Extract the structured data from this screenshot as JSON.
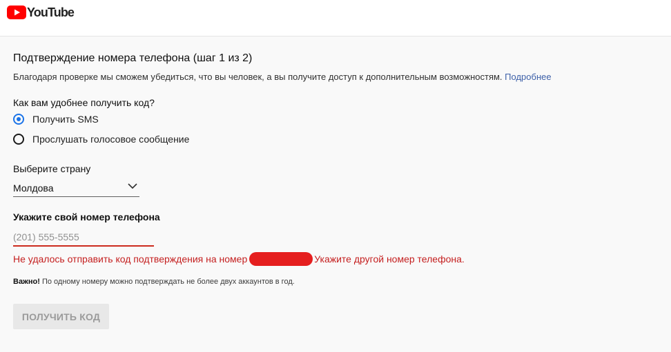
{
  "header": {
    "logo_text": "YouTube",
    "logo_color": "#ff0000"
  },
  "form": {
    "title": "Подтверждение номера телефона (шаг 1 из 2)",
    "description": "Благодаря проверке мы сможем убедиться, что вы человек, а вы получите доступ к дополнительным возможностям.",
    "learn_more_link": "Подробнее",
    "method_question": "Как вам удобнее получить код?",
    "methods": [
      {
        "label": "Получить SMS",
        "selected": true
      },
      {
        "label": "Прослушать голосовое сообщение",
        "selected": false
      }
    ],
    "country_label": "Выберите страну",
    "country_value": "Молдова",
    "phone_label": "Укажите свой номер телефона",
    "phone_placeholder": "(201) 555-5555",
    "phone_value": "",
    "error_prefix": "Не удалось отправить код подтверждения на номер",
    "error_suffix": "Укажите другой номер телефона.",
    "note_bold": "Важно!",
    "note_text": "По одному номеру можно подтверждать не более двух аккаунтов в год.",
    "submit_label": "ПОЛУЧИТЬ КОД",
    "accent_color": "#1a73e8",
    "error_color": "#c41e1e"
  }
}
